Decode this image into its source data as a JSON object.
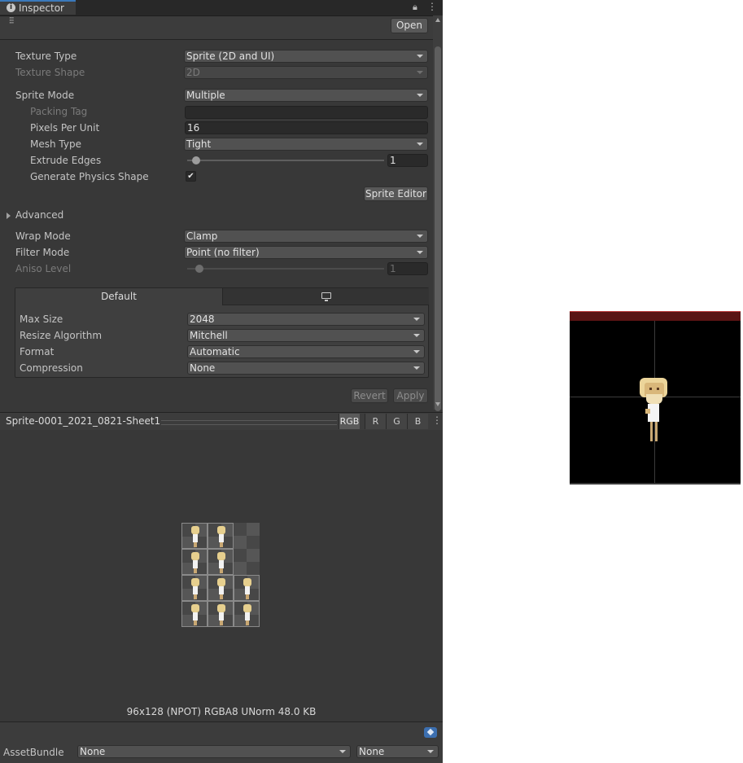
{
  "window": {
    "tab_title": "Inspector"
  },
  "header": {
    "open_label": "Open"
  },
  "fields": {
    "texture_type": {
      "label": "Texture Type",
      "value": "Sprite (2D and UI)"
    },
    "texture_shape": {
      "label": "Texture Shape",
      "value": "2D"
    },
    "sprite_mode": {
      "label": "Sprite Mode",
      "value": "Multiple"
    },
    "packing_tag": {
      "label": "Packing Tag",
      "value": ""
    },
    "pixels_per_unit": {
      "label": "Pixels Per Unit",
      "value": "16"
    },
    "mesh_type": {
      "label": "Mesh Type",
      "value": "Tight"
    },
    "extrude_edges": {
      "label": "Extrude Edges",
      "value": "1"
    },
    "generate_physics": {
      "label": "Generate Physics Shape",
      "checked": true,
      "check_glyph": "✔"
    },
    "sprite_editor_label": "Sprite Editor",
    "advanced_label": "Advanced",
    "wrap_mode": {
      "label": "Wrap Mode",
      "value": "Clamp"
    },
    "filter_mode": {
      "label": "Filter Mode",
      "value": "Point (no filter)"
    },
    "aniso_level": {
      "label": "Aniso Level",
      "value": "1"
    }
  },
  "platform": {
    "tabs": {
      "default_label": "Default",
      "standalone_icon": "monitor-icon"
    },
    "max_size": {
      "label": "Max Size",
      "value": "2048"
    },
    "resize_algorithm": {
      "label": "Resize Algorithm",
      "value": "Mitchell"
    },
    "format": {
      "label": "Format",
      "value": "Automatic"
    },
    "compression": {
      "label": "Compression",
      "value": "None"
    }
  },
  "actions": {
    "revert_label": "Revert",
    "apply_label": "Apply"
  },
  "preview": {
    "asset_name": "Sprite-0001_2021_0821-Sheet1",
    "channels": [
      "RGB",
      "R",
      "G",
      "B"
    ],
    "info": "96x128 (NPOT)  RGBA8 UNorm   48.0 KB"
  },
  "asset_bundle": {
    "label": "AssetBundle",
    "name_value": "None",
    "variant_value": "None"
  },
  "colors": {
    "panel_bg": "#383838",
    "accent": "#3a79bb",
    "preview_top": "#5a1414"
  }
}
